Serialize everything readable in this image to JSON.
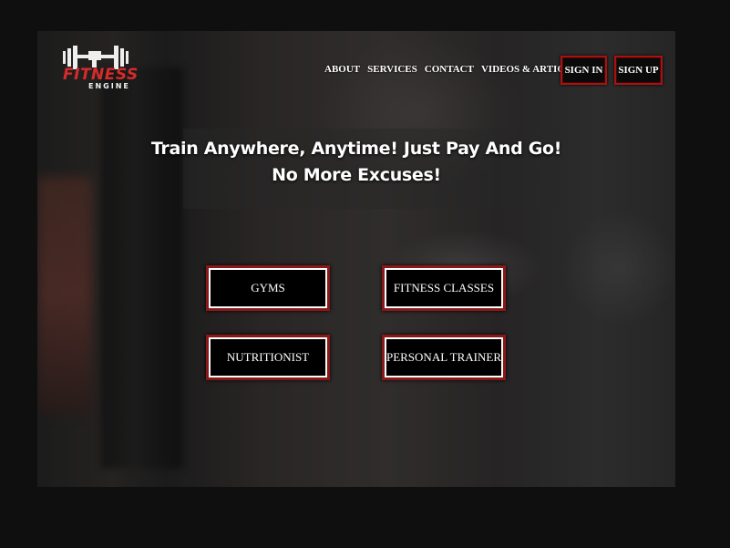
{
  "brand": {
    "logo_word": "FITNESS",
    "logo_sub": "ENGINE"
  },
  "nav": [
    "ABOUT",
    "SERVICES",
    "CONTACT",
    "VIDEOS & ARTICLES"
  ],
  "auth": {
    "sign_in": "SIGN IN",
    "sign_up": "SIGN UP"
  },
  "hero": {
    "line1": "Train Anywhere, Anytime! Just Pay And Go!",
    "line2": "No More Excuses!"
  },
  "categories": [
    "GYMS",
    "FITNESS CLASSES",
    "NUTRITIONIST",
    "PERSONAL TRAINER"
  ],
  "colors": {
    "accent": "#d62b2b",
    "page_bg": "#0f0f0f",
    "tile_bg": "#000000"
  }
}
